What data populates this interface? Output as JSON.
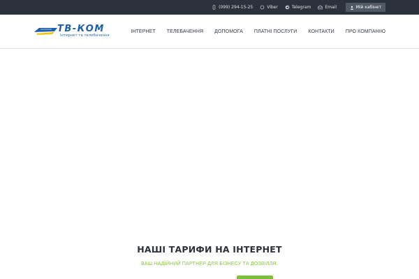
{
  "topbar": {
    "phone": "(099) 294-15-25",
    "viber": "Viber",
    "telegram": "Telegram",
    "email": "Email",
    "cabinet_label": "Мій кабінет",
    "icons": [
      "phone-icon",
      "viber-icon",
      "telegram-icon",
      "email-icon",
      "user-icon"
    ]
  },
  "logo": {
    "title": "ТВ-КОМ",
    "subtitle": "інтернет та телебачення"
  },
  "nav": {
    "items": [
      "ІНТЕРНЕТ",
      "ТЕЛЕБАЧЕННЯ",
      "ДОПОМОГА",
      "ПЛАТНІ ПОСЛУГИ",
      "КОНТАКТИ",
      "ПРО КОМПАНІЮ"
    ]
  },
  "main": {
    "title": "НАШІ ТАРИФИ НА ІНТЕРНЕТ",
    "subtitle": "ВАШ НАДІЙНИЙ ПАРТНЕР ДЛЯ БІЗНЕСУ ТА ДОЗВІЛЛЯ."
  },
  "colors": {
    "topbar_bg": "#2b323b",
    "brand_blue": "#1f5fa8",
    "accent_green": "#8cc63f"
  }
}
